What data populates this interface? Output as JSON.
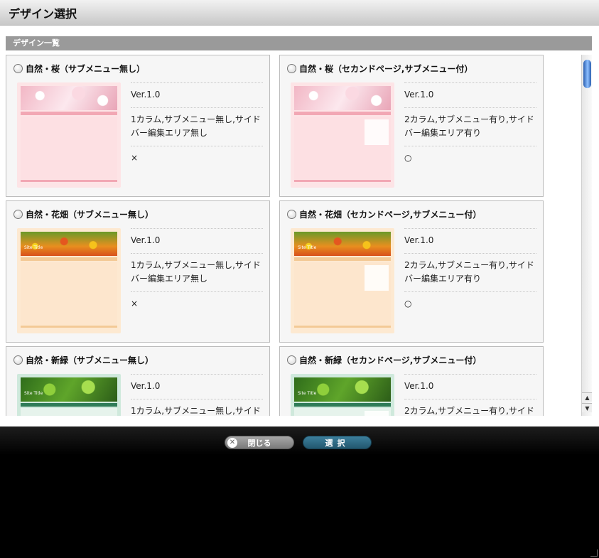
{
  "window": {
    "title": "デザイン選択"
  },
  "section": {
    "title": "デザイン一覧"
  },
  "cards": [
    {
      "name": "自然・桜（サブメニュー無し）",
      "version": "Ver.1.0",
      "description": "1カラム,サブメニュー無し,サイドバー編集エリア無し",
      "sidebar": "×",
      "theme": "sakura",
      "layout": "one",
      "bg": "#fde4e6",
      "banner": "#f6c1cd",
      "nav": "#f2a7b4",
      "body": "#fde0e3"
    },
    {
      "name": "自然・桜（セカンドページ,サブメニュー付）",
      "version": "Ver.1.0",
      "description": "2カラム,サブメニュー有り,サイドバー編集エリア有り",
      "sidebar": "○",
      "theme": "sakura",
      "layout": "two",
      "bg": "#fde4e6",
      "banner": "#f6c1cd",
      "nav": "#f2a7b4",
      "body": "#fde0e3"
    },
    {
      "name": "自然・花畑（サブメニュー無し）",
      "version": "Ver.1.0",
      "description": "1カラム,サブメニュー無し,サイドバー編集エリア無し",
      "sidebar": "×",
      "theme": "flower",
      "layout": "one",
      "bg": "#fde9d1",
      "banner": "#e7a12b",
      "nav": "#f3c996",
      "body": "#fde6cd",
      "site_title": "Site Title"
    },
    {
      "name": "自然・花畑（セカンドページ,サブメニュー付）",
      "version": "Ver.1.0",
      "description": "2カラム,サブメニュー有り,サイドバー編集エリア有り",
      "sidebar": "○",
      "theme": "flower",
      "layout": "two",
      "bg": "#fde9d1",
      "banner": "#e7a12b",
      "nav": "#f3c996",
      "body": "#fde6cd",
      "site_title": "Site Title"
    },
    {
      "name": "自然・新緑（サブメニュー無し）",
      "version": "Ver.1.0",
      "description": "1カラム,サブメニュー無し,サイドバー編集エリア無し",
      "sidebar": "×",
      "theme": "green",
      "layout": "one",
      "bg": "#cfe9dc",
      "banner": "#4c8b2c",
      "nav": "#2f7c58",
      "body": "#e6f3ec",
      "site_title": "Site Title"
    },
    {
      "name": "自然・新緑（セカンドページ,サブメニュー付）",
      "version": "Ver.1.0",
      "description": "2カラム,サブメニュー有り,サイドバー編集エリア有り",
      "sidebar": "○",
      "theme": "green",
      "layout": "two",
      "bg": "#cfe9dc",
      "banner": "#4c8b2c",
      "nav": "#2f7c58",
      "body": "#e6f3ec",
      "site_title": "Site Title"
    }
  ],
  "buttons": {
    "close": "閉じる",
    "select": "選択"
  },
  "icons": {
    "close": "close-circle-icon",
    "up": "arrow-up-icon",
    "down": "arrow-down-icon"
  }
}
